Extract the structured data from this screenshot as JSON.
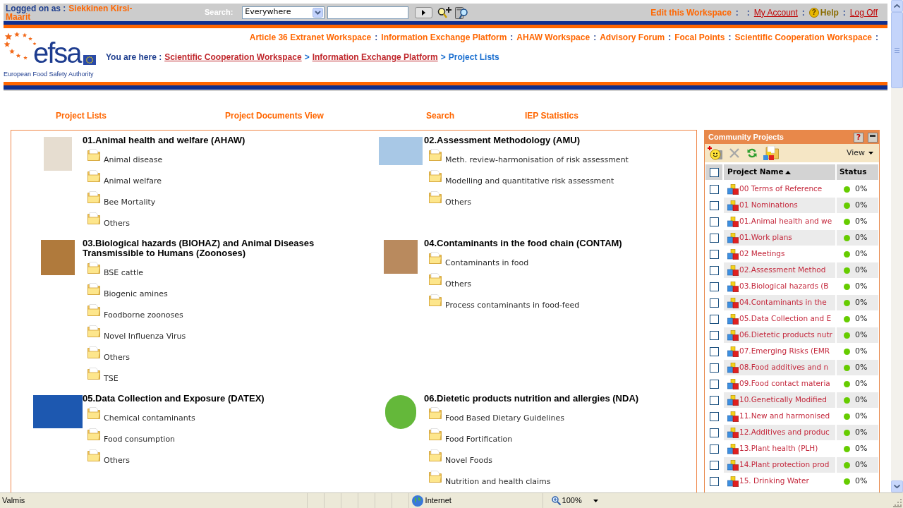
{
  "top_bar": {
    "logged_on_label": "Logged on as :",
    "user_name": "Siekkinen Kirsi-Maarit",
    "search_label": "Search:",
    "search_scope": "Everywhere",
    "actions": [
      {
        "kind": "edit",
        "text": "Edit this Workspace"
      },
      {
        "kind": "separator",
        "text": ":"
      },
      {
        "kind": "separator",
        "text": ":"
      },
      {
        "kind": "link",
        "text": "My Account"
      },
      {
        "kind": "separator",
        "text": ":"
      },
      {
        "kind": "help",
        "text": "Help",
        "glyph": "?"
      },
      {
        "kind": "separator",
        "text": ":"
      },
      {
        "kind": "link",
        "text": "Log Off"
      }
    ]
  },
  "logo": {
    "wordmark": "efsa",
    "tagline": "European Food Safety Authority"
  },
  "workspace_nav": [
    {
      "kind": "link",
      "text": "Article 36 Extranet Workspace"
    },
    {
      "kind": "separator",
      "text": ":"
    },
    {
      "kind": "link",
      "text": "Information Exchange Platform"
    },
    {
      "kind": "separator",
      "text": ":"
    },
    {
      "kind": "link",
      "text": "AHAW Workspace"
    },
    {
      "kind": "separator",
      "text": ":"
    },
    {
      "kind": "link",
      "text": "Advisory Forum"
    },
    {
      "kind": "separator",
      "text": ":"
    },
    {
      "kind": "link",
      "text": "Focal Points"
    },
    {
      "kind": "separator",
      "text": ":"
    },
    {
      "kind": "link",
      "text": "Scientific Cooperation Workspace"
    },
    {
      "kind": "separator",
      "text": ":"
    }
  ],
  "breadcrumb": [
    {
      "kind": "label",
      "text": "You are here :"
    },
    {
      "kind": "link",
      "text": "Scientific Cooperation Workspace"
    },
    {
      "kind": "separator",
      "text": ">"
    },
    {
      "kind": "link",
      "text": "Information Exchange Platform"
    },
    {
      "kind": "separator",
      "text": ">"
    },
    {
      "kind": "current",
      "text": "Project Lists"
    }
  ],
  "view_links": [
    "Project Lists",
    "Project Documents View",
    "Search",
    "IEP Statistics"
  ],
  "categories": [
    {
      "title": "01.Animal health and welfare (AHAW)",
      "folders": [
        "Animal disease",
        "Animal welfare",
        "Bee Mortality",
        "Others"
      ]
    },
    {
      "title": "02.Assessment Methodology (AMU)",
      "folders": [
        "Meth. review-harmonisation of risk assessment",
        "Modelling and quantitative risk assessment",
        "Others"
      ]
    },
    {
      "title": "03.Biological hazards (BIOHAZ) and Animal Diseases Transmissible to Humans (Zoonoses)",
      "folders": [
        "BSE cattle",
        "Biogenic amines",
        "Foodborne zoonoses",
        "Novel Influenza Virus",
        "Others",
        "TSE"
      ]
    },
    {
      "title": "04.Contaminants in the food chain (CONTAM)",
      "folders": [
        "Contaminants in food",
        "Others",
        "Process contaminants in food-feed"
      ]
    },
    {
      "title": "05.Data Collection and Exposure (DATEX)",
      "folders": [
        "Chemical contaminants",
        "Food consumption",
        "Others"
      ]
    },
    {
      "title": "06.Dietetic products nutrition and allergies (NDA)",
      "folders": [
        "Food Based Dietary Guidelines",
        "Food Fortification",
        "Novel Foods",
        "Nutrition and health claims"
      ]
    }
  ],
  "community_projects": {
    "title": "Community Projects",
    "help_glyph": "?",
    "toolbar": [
      {
        "kind": "new",
        "disabled": false
      },
      {
        "kind": "delete",
        "disabled": true
      },
      {
        "kind": "refresh",
        "disabled": false
      },
      {
        "kind": "folder",
        "disabled": false
      }
    ],
    "view_label": "View",
    "columns": [
      "Project Name",
      "Status"
    ],
    "select_all_checked": false,
    "rows": [
      {
        "name": "00 Terms of Reference",
        "checked": false,
        "color": "#66cc00",
        "progress": "0%"
      },
      {
        "name": "01 Nominations",
        "checked": false,
        "color": "#66cc00",
        "progress": "0%"
      },
      {
        "name": "01.Animal health and we",
        "checked": false,
        "color": "#66cc00",
        "progress": "0%"
      },
      {
        "name": "01.Work plans",
        "checked": false,
        "color": "#66cc00",
        "progress": "0%"
      },
      {
        "name": "02 Meetings",
        "checked": false,
        "color": "#66cc00",
        "progress": "0%"
      },
      {
        "name": "02.Assessment Method",
        "checked": false,
        "color": "#66cc00",
        "progress": "0%"
      },
      {
        "name": "03.Biological hazards (B",
        "checked": false,
        "color": "#66cc00",
        "progress": "0%"
      },
      {
        "name": "04.Contaminants in the",
        "checked": false,
        "color": "#66cc00",
        "progress": "0%"
      },
      {
        "name": "05.Data Collection and E",
        "checked": false,
        "color": "#66cc00",
        "progress": "0%"
      },
      {
        "name": "06.Dietetic products nutr",
        "checked": false,
        "color": "#66cc00",
        "progress": "0%"
      },
      {
        "name": "07.Emerging Risks (EMR",
        "checked": false,
        "color": "#66cc00",
        "progress": "0%"
      },
      {
        "name": "08.Food additives and n",
        "checked": false,
        "color": "#66cc00",
        "progress": "0%"
      },
      {
        "name": "09.Food contact materia",
        "checked": false,
        "color": "#66cc00",
        "progress": "0%"
      },
      {
        "name": "10.Genetically Modified",
        "checked": false,
        "color": "#66cc00",
        "progress": "0%"
      },
      {
        "name": "11.New and harmonised",
        "checked": false,
        "color": "#66cc00",
        "progress": "0%"
      },
      {
        "name": "12.Additives and produc",
        "checked": false,
        "color": "#66cc00",
        "progress": "0%"
      },
      {
        "name": "13.Plant health (PLH)",
        "checked": false,
        "color": "#66cc00",
        "progress": "0%"
      },
      {
        "name": "14.Plant protection prod",
        "checked": false,
        "color": "#66cc00",
        "progress": "0%"
      },
      {
        "name": "15. Drinking Water",
        "checked": false,
        "color": "#66cc00",
        "progress": "0%"
      }
    ]
  },
  "status_bar": {
    "text": "Valmis",
    "zone": "Internet",
    "zoom": "100%"
  }
}
